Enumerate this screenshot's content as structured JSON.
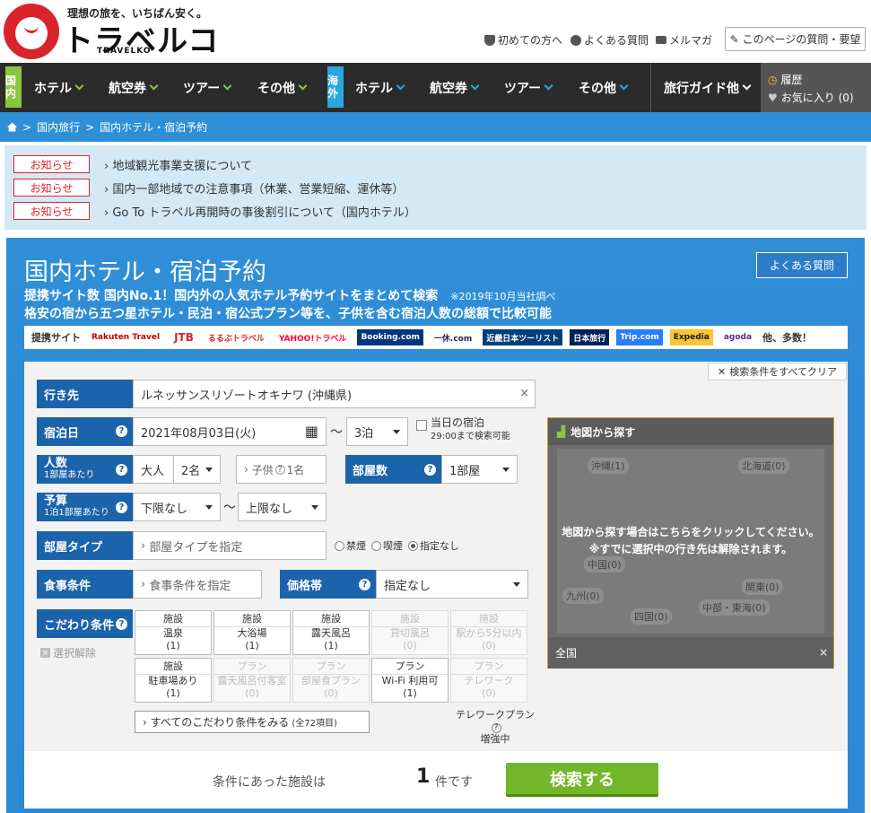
{
  "header": {
    "tagline": "理想の旅を、いちばん安く。",
    "logo_name": "トラベルコ",
    "logo_sub": "TRAVELKO",
    "links": [
      {
        "label": "初めての方へ",
        "icon": "shield-icon"
      },
      {
        "label": "よくある質問",
        "icon": "question-icon"
      },
      {
        "label": "メルマガ",
        "icon": "mail-icon"
      }
    ],
    "page_question_label": "このページの質問・要望"
  },
  "nav": {
    "domestic_badge": "国内",
    "overseas_badge": "海外",
    "domestic_items": [
      "ホテル",
      "航空券",
      "ツアー",
      "その他"
    ],
    "overseas_items": [
      "ホテル",
      "航空券",
      "ツアー",
      "その他"
    ],
    "guide_label": "旅行ガイド他",
    "history_label": "履歴",
    "favorites_label": "お気に入り (0)",
    "colors": {
      "domestic": "#8cc63f",
      "overseas": "#29a8e0"
    }
  },
  "breadcrumb": [
    "国内旅行",
    "国内ホテル・宿泊予約"
  ],
  "notices": [
    {
      "tag": "お知らせ",
      "text": "地域観光事業支援について"
    },
    {
      "tag": "お知らせ",
      "text": "国内一部地域での注意事項（休業、営業短縮、運休等）"
    },
    {
      "tag": "お知らせ",
      "text": "Go To トラベル再開時の事後割引について（国内ホテル）"
    }
  ],
  "main": {
    "title": "国内ホテル・宿泊予約",
    "faq_label": "よくある質問",
    "sub1": "提携サイト数 国内No.1！国内外の人気ホテル予約サイトをまとめて検索",
    "sub1_note": "※2019年10月当社調べ",
    "sub2": "格安の宿から五つ星ホテル・民泊・宿公式プラン等を、子供を含む宿泊人数の総額で比較可能",
    "partners_label": "提携サイト",
    "partners": [
      "Rakuten Travel",
      "JTB",
      "るるぶトラベル",
      "YAHOO!トラベル",
      "Booking.com",
      "一休.com",
      "近畿日本ツーリスト",
      "日本旅行",
      "Trip.com",
      "Expedia",
      "agoda"
    ],
    "partners_more": "他、多数！"
  },
  "form": {
    "clear_label": "検索条件をすべてクリア",
    "destination_label": "行き先",
    "destination_value": "ルネッサンスリゾートオキナワ (沖縄県)",
    "date_label": "宿泊日",
    "date_value": "2021年08月03日(火)",
    "nights_value": "3泊",
    "same_day_label": "当日の宿泊",
    "same_day_note": "29:00まで検索可能",
    "people_label": "人数",
    "people_sub": "1部屋あたり",
    "adult_label": "大人",
    "adult_value": "2名",
    "child_value": "子供",
    "child_count": "1名",
    "rooms_label": "部屋数",
    "rooms_value": "1部屋",
    "budget_label": "予算",
    "budget_sub": "1泊1部屋あたり",
    "budget_min": "下限なし",
    "budget_max": "上限なし",
    "room_type_label": "部屋タイプ",
    "room_type_placeholder": "部屋タイプを指定",
    "smoking_options": [
      "禁煙",
      "喫煙",
      "指定なし"
    ],
    "meal_label": "食事条件",
    "meal_placeholder": "食事条件を指定",
    "price_label": "価格帯",
    "price_value": "指定なし",
    "kodawari_label": "こだわり条件",
    "deselect_label": "選択解除",
    "conditions": [
      {
        "cat": "施設",
        "name": "温泉",
        "count": "(1)",
        "enabled": true
      },
      {
        "cat": "施設",
        "name": "大浴場",
        "count": "(1)",
        "enabled": true
      },
      {
        "cat": "施設",
        "name": "露天風呂",
        "count": "(1)",
        "enabled": true
      },
      {
        "cat": "施設",
        "name": "貸切風呂",
        "count": "(0)",
        "enabled": false
      },
      {
        "cat": "施設",
        "name": "駅から5分以内",
        "count": "(0)",
        "enabled": false
      },
      {
        "cat": "施設",
        "name": "駐車場あり",
        "count": "(1)",
        "enabled": true
      },
      {
        "cat": "プラン",
        "name": "露天風呂付客室",
        "count": "(0)",
        "enabled": false
      },
      {
        "cat": "プラン",
        "name": "部屋食プラン",
        "count": "(0)",
        "enabled": false
      },
      {
        "cat": "プラン",
        "name": "Wi-Fi 利用可",
        "count": "(1)",
        "enabled": true
      },
      {
        "cat": "プラン",
        "name": "テレワーク",
        "count": "(0)",
        "enabled": false
      }
    ],
    "more_conditions_label": "すべてのこだわり条件をみる",
    "more_conditions_count": "(全72項目)",
    "telework_label": "テレワークプラン",
    "telework_sub": "増強中"
  },
  "map": {
    "title": "地図から探す",
    "regions": [
      "沖縄(1)",
      "北海道(0)",
      "中国(0)",
      "九州(0)",
      "四国(0)",
      "関東(0)",
      "中部・東海(0)"
    ],
    "message1": "地図から探す場合はこちらをクリックしてください。",
    "message2": "※すでに選択中の行き先は解除されます。",
    "footer": "全国"
  },
  "result": {
    "prefix": "条件にあった施設は",
    "count": "1",
    "suffix": "件です",
    "search_label": "検索する"
  }
}
